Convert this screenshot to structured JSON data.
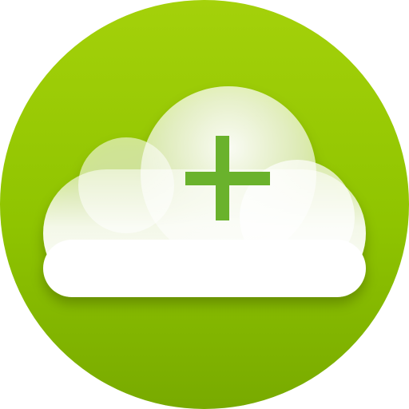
{
  "app_icon": {
    "name": "cloud-add-icon",
    "colors": {
      "circle_light": "#a4d10a",
      "circle_mid": "#8fc400",
      "circle_dark": "#78aa00",
      "cloud": "#ffffff",
      "plus": "#6ab22c"
    },
    "parts": [
      "green-circle-background",
      "cloud-icon",
      "plus-icon"
    ]
  }
}
